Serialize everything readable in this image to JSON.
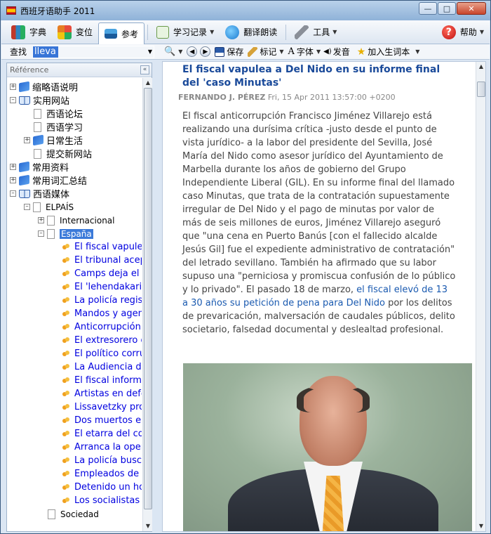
{
  "window": {
    "title": "西班牙语助手 2011"
  },
  "toolbar": {
    "dict": "字典",
    "conj": "变位",
    "ref": "参考",
    "record": "学习记录",
    "translate": "翻译朗读",
    "tools": "工具",
    "help": "帮助"
  },
  "searchbar": {
    "label": "查找",
    "value": "llevar",
    "save": "保存",
    "mark": "标记",
    "font": "字体",
    "speak": "发音",
    "add_word": "加入生词本"
  },
  "left_panel": {
    "header": "Référence",
    "tree": [
      {
        "label": "缩略语说明"
      },
      {
        "label": "实用网站"
      },
      {
        "label": "西语论坛"
      },
      {
        "label": "西语学习"
      },
      {
        "label": "日常生活"
      },
      {
        "label": "提交新网站"
      },
      {
        "label": "常用资料"
      },
      {
        "label": "常用词汇总结"
      },
      {
        "label": "西语媒体"
      },
      {
        "label": "ELPAÍS"
      },
      {
        "label": "Internacional"
      },
      {
        "label": "España"
      },
      {
        "label": "Sociedad"
      }
    ],
    "articles": [
      "El fiscal vapulea",
      "El tribunal acepta",
      "Camps deja el ho",
      "El 'lehendakari' d",
      "La policía registr",
      "Mandos y agente",
      "Anticorrupción so",
      "El extresorero de",
      "El político corrup",
      "La Audiencia de",
      "El fiscal informa",
      "Artistas en defer",
      "Lissavetzky prop",
      "Dos muertos en",
      "El etarra del con",
      "Arranca la opera",
      "La policía busca",
      "Empleados de M",
      "Detenido un hon",
      "Los socialistas p"
    ]
  },
  "article": {
    "title": "El fiscal vapulea a Del Nido en su informe final del 'caso Minutas'",
    "author": "FERNANDO J. PÉREZ",
    "date": "Fri, 15 Apr 2011 13:57:00 +0200",
    "body_1": "El fiscal anticorrupción Francisco Jiménez Villarejo está realizando una durísima crítica -justo desde el punto de vista jurídico- a la labor del presidente del Sevilla, José María del Nido como asesor jurídico del Ayuntamiento de Marbella durante los años de gobierno del Grupo Independiente Liberal (GIL). En su informe final del llamado caso Minutas, que trata de la contratación supuestamente irregular de Del Nido y el pago de minutas por valor de más de seis millones de euros, Jiménez Villarejo aseguró que \"una cena en Puerto Banús [con el fallecido alcalde Jesús Gil] fue el expediente administrativo de contratación\" del letrado sevillano. También ha afirmado que su labor supuso una \"perniciosa y promiscua confusión de lo público y lo privado\". El pasado 18 de marzo, ",
    "body_link": "el fiscal elevó de 13 a 30 años su petición de pena para Del Nido",
    "body_2": " por los delitos de prevaricación, malversación de caudales públicos, delito societario, falsedad documental y deslealtad profesional."
  }
}
